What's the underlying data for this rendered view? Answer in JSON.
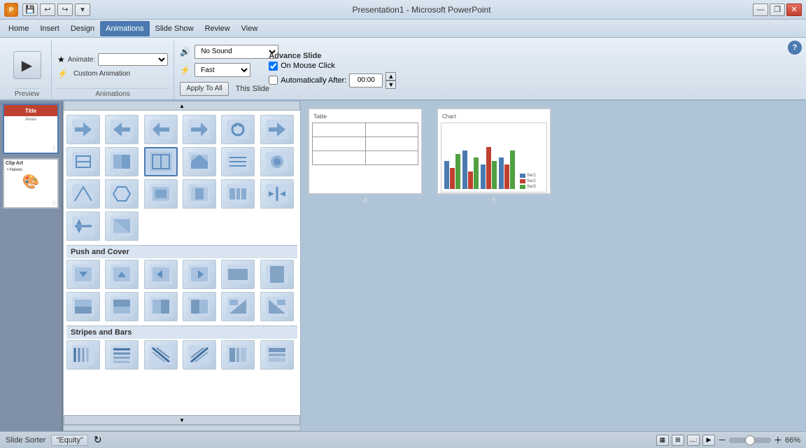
{
  "titlebar": {
    "title": "Presentation1 - Microsoft PowerPoint",
    "min_btn": "—",
    "max_btn": "❐",
    "close_btn": "✕"
  },
  "menu": {
    "items": [
      "Home",
      "Insert",
      "Design",
      "Animations",
      "Slide Show",
      "Review",
      "View"
    ],
    "active": "Animations"
  },
  "ribbon": {
    "preview_label": "Preview",
    "animations_label": "Animations",
    "custom_anim_label": "Custom Animation",
    "sound_label": "No Sound",
    "speed_label": "Fast",
    "advance_slide_label": "Advance Slide",
    "on_mouse_click_label": "On Mouse Click",
    "auto_after_label": "Automatically After:",
    "auto_time": "00:00",
    "apply_all_label": "Apply To All",
    "this_slide_label": "This Slide"
  },
  "transition_panel": {
    "sections": [
      {
        "name": "",
        "items": [
          "⬇",
          "⬅",
          "➡",
          "⬆",
          "↩",
          "⬇",
          "⬅",
          "➡",
          "⬆",
          "↩",
          "⬅",
          "⬇",
          "⬇",
          "⬅",
          "➡",
          "⬆",
          "↩",
          "⬇",
          "⬅",
          "➡",
          "⬆",
          "↩",
          "⬅",
          "⬇",
          "⬇",
          "⬅",
          "➡",
          "⬆",
          "↩",
          "⬇",
          "⬅",
          "➡",
          "⬆",
          "↩",
          "⬅",
          "⬇",
          "⬇",
          "⬅",
          "➡",
          "⬆",
          "↩",
          "⬇"
        ]
      },
      {
        "name": "Push and Cover",
        "items": [
          "⬇",
          "⬅",
          "➡",
          "⬆",
          "↩",
          "⬇",
          "⬅",
          "➡",
          "⬆",
          "↩",
          "⬅",
          "⬇"
        ]
      },
      {
        "name": "Stripes and Bars",
        "items": [
          "⬇",
          "⬅",
          "➡",
          "⬆",
          "↩",
          "⬇"
        ]
      }
    ]
  },
  "slides": [
    {
      "num": "1",
      "title": "Title",
      "subtitle": "Areas"
    },
    {
      "num": "6",
      "title": "Clip Art",
      "bullet": "• Halves"
    }
  ],
  "content_slides": [
    {
      "num": "4",
      "type": "table",
      "title": "Table"
    },
    {
      "num": "5",
      "type": "chart",
      "title": "Chart"
    }
  ],
  "statusbar": {
    "slide_sorter": "Slide Sorter",
    "theme": "\"Equity\"",
    "zoom_level": "66%",
    "zoom_min": "-",
    "zoom_max": "+"
  },
  "icons": {
    "sound": "🔊",
    "animate": "★",
    "preview": "▶",
    "help": "?"
  }
}
